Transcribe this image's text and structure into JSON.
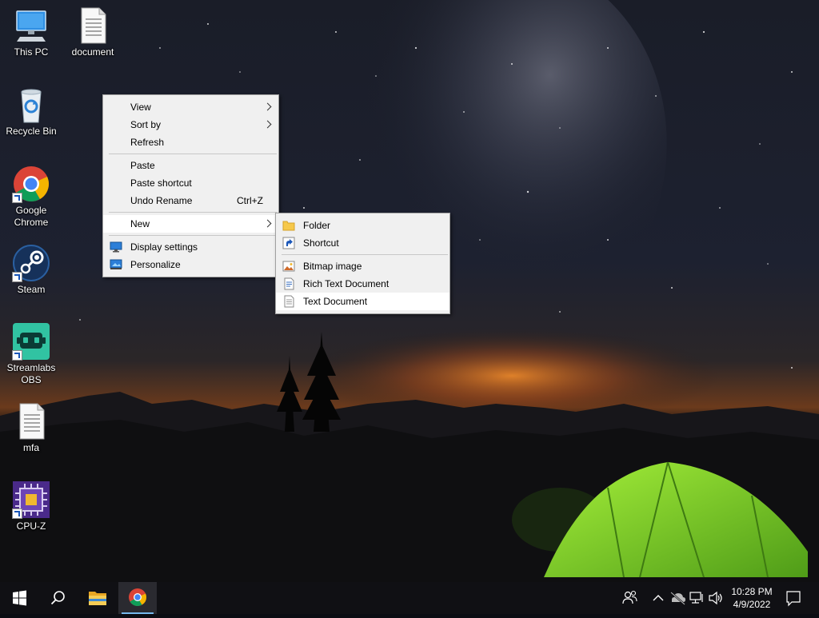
{
  "desktop": {
    "icons": [
      {
        "label": "This PC",
        "icon": "computer-icon"
      },
      {
        "label": "document",
        "icon": "text-file-icon"
      },
      {
        "label": "Recycle Bin",
        "icon": "recycle-bin-icon"
      },
      {
        "label": "Google Chrome",
        "icon": "chrome-icon",
        "shortcut": true
      },
      {
        "label": "Steam",
        "icon": "steam-icon",
        "shortcut": true
      },
      {
        "label": "Streamlabs OBS",
        "icon": "streamlabs-icon",
        "shortcut": true
      },
      {
        "label": "mfa",
        "icon": "text-file-icon"
      },
      {
        "label": "CPU-Z",
        "icon": "cpu-z-icon",
        "shortcut": true
      }
    ]
  },
  "context_menu": {
    "view": "View",
    "sort_by": "Sort by",
    "refresh": "Refresh",
    "paste": "Paste",
    "paste_shortcut": "Paste shortcut",
    "undo_rename": "Undo Rename",
    "undo_rename_key": "Ctrl+Z",
    "new": "New",
    "display_settings": "Display settings",
    "personalize": "Personalize"
  },
  "new_submenu": {
    "folder": "Folder",
    "shortcut": "Shortcut",
    "bitmap_image": "Bitmap image",
    "rich_text_document": "Rich Text Document",
    "text_document": "Text Document"
  },
  "taskbar": {
    "time": "10:28 PM",
    "date": "4/9/2022",
    "pinned": [
      "start-icon",
      "search-icon",
      "file-explorer-icon",
      "chrome-icon"
    ],
    "tray": [
      "people-icon",
      "chevron-up-icon",
      "cloud-offline-icon",
      "network-icon",
      "volume-icon",
      "notification-icon"
    ]
  },
  "colors": {
    "menu_bg": "#f0f0f0",
    "menu_hover": "#ffffff",
    "taskbar_bg": "#101014",
    "active_underline": "#76b9ed",
    "tent_green": "#7fd62a"
  }
}
